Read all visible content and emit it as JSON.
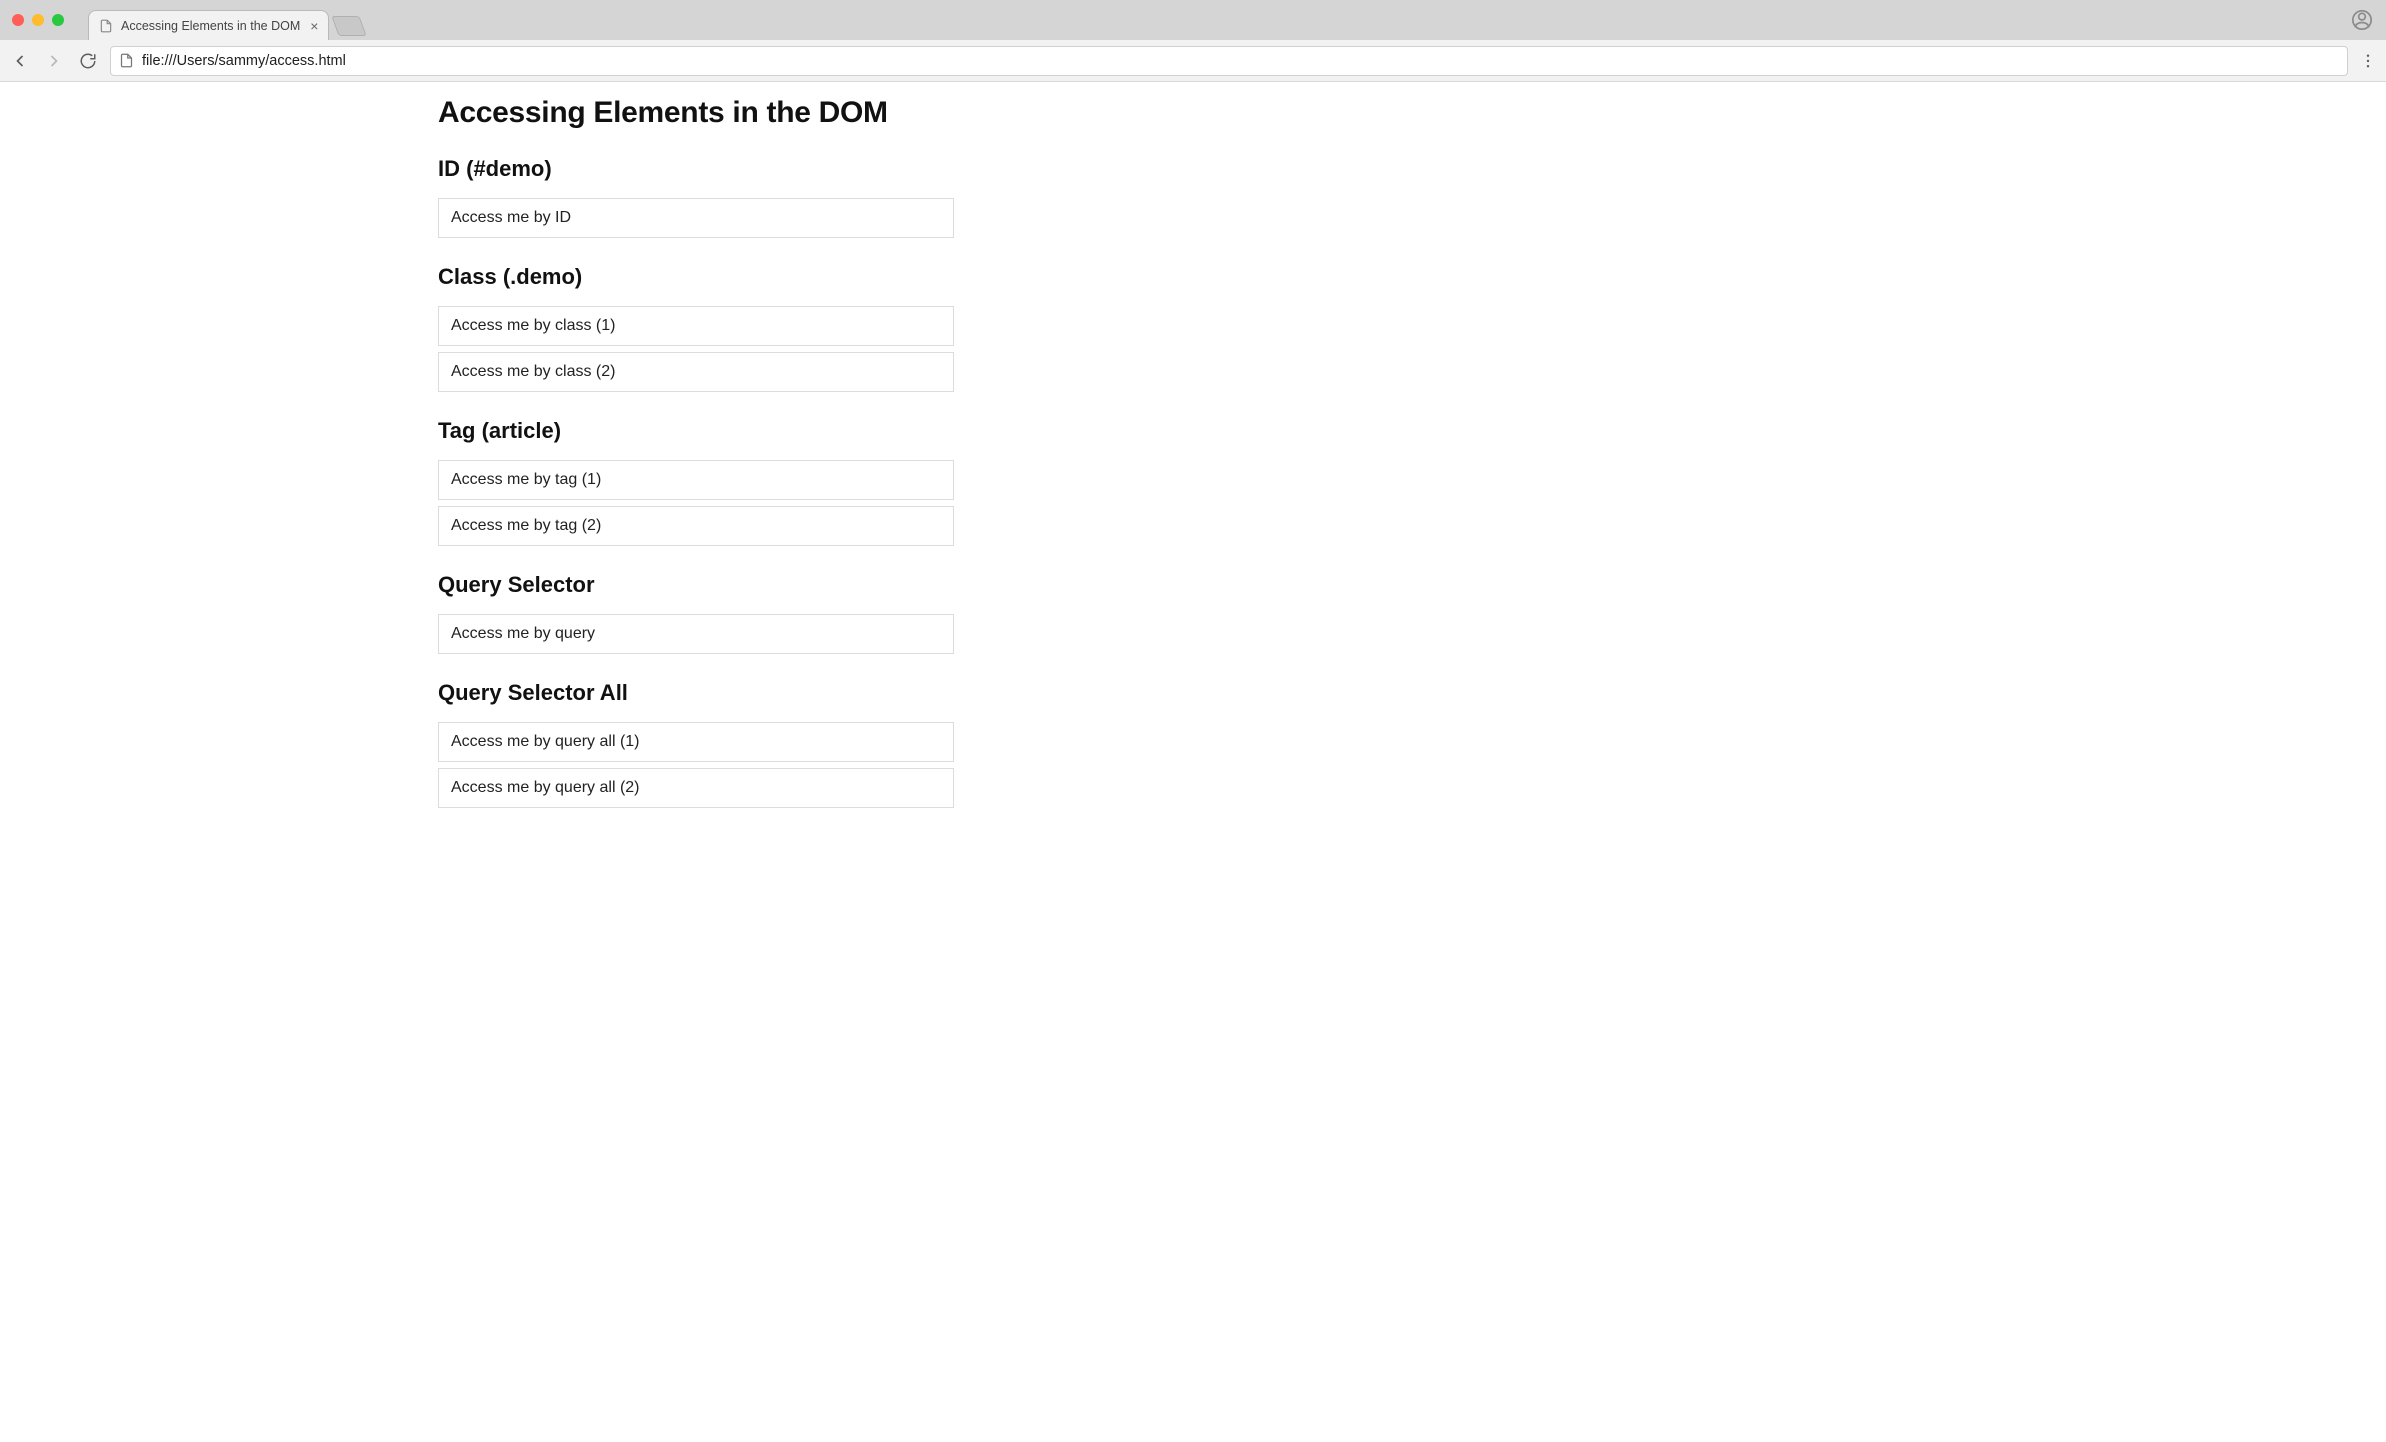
{
  "browser": {
    "tab_title": "Accessing Elements in the DOM",
    "url": "file:///Users/sammy/access.html"
  },
  "page": {
    "h1": "Accessing Elements in the DOM",
    "sections": [
      {
        "heading": "ID (#demo)",
        "items": [
          "Access me by ID"
        ]
      },
      {
        "heading": "Class (.demo)",
        "items": [
          "Access me by class (1)",
          "Access me by class (2)"
        ]
      },
      {
        "heading": "Tag (article)",
        "items": [
          "Access me by tag (1)",
          "Access me by tag (2)"
        ]
      },
      {
        "heading": "Query Selector",
        "items": [
          "Access me by query"
        ]
      },
      {
        "heading": "Query Selector All",
        "items": [
          "Access me by query all (1)",
          "Access me by query all (2)"
        ]
      }
    ]
  }
}
